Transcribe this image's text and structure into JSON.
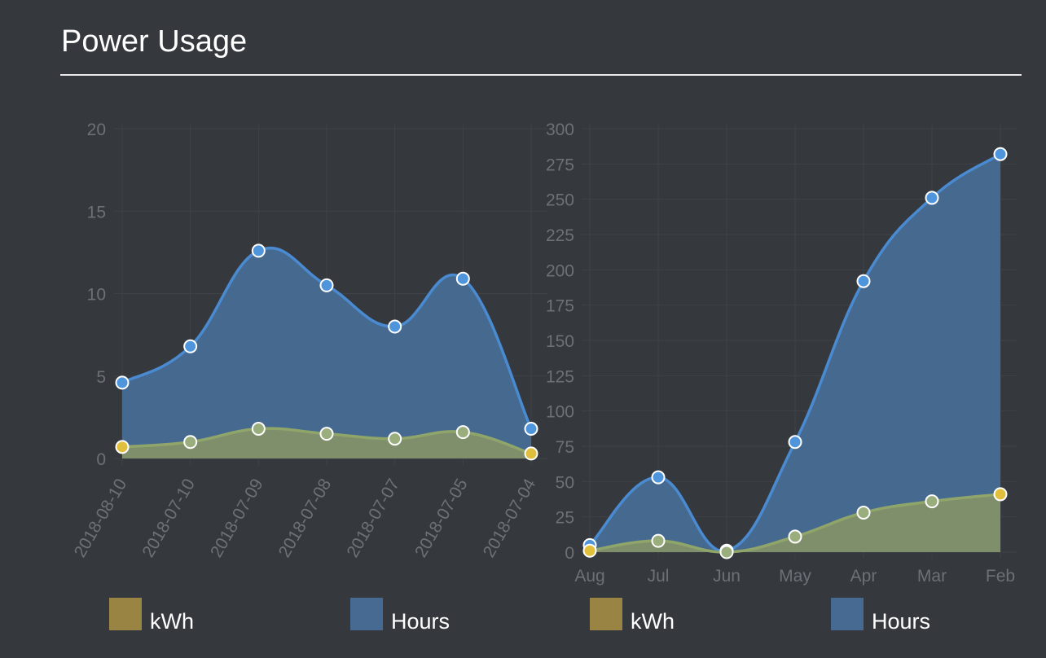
{
  "page": {
    "title": "Power Usage"
  },
  "colors": {
    "kwh_swatch": "#9a8444",
    "hours_swatch": "#466a92",
    "kwh_line": "#8fa56a",
    "kwh_fill": "#7f8f6c",
    "hours_line": "#4a8ad0",
    "hours_fill": "#45698f",
    "point_blue": "#4f95dc",
    "point_yellow": "#e0bf3c",
    "point_green": "#9aad7c",
    "grid": "#3f4248",
    "tick_text": "#6d7076"
  },
  "chart_data": [
    {
      "type": "area",
      "categories": [
        "2018-08-10",
        "2018-07-10",
        "2018-07-09",
        "2018-07-08",
        "2018-07-07",
        "2018-07-05",
        "2018-07-04"
      ],
      "series": [
        {
          "name": "kWh",
          "values": [
            0.7,
            1.0,
            1.8,
            1.5,
            1.2,
            1.6,
            0.3
          ]
        },
        {
          "name": "Hours",
          "values": [
            4.6,
            6.8,
            12.6,
            10.5,
            8.0,
            10.9,
            1.8
          ]
        }
      ],
      "yticks": [
        0,
        5,
        10,
        15,
        20
      ],
      "ylim": [
        0,
        20
      ],
      "grid": true,
      "legend": "bottom",
      "legend_labels": [
        "kWh",
        "Hours"
      ]
    },
    {
      "type": "area",
      "categories": [
        "Aug",
        "Jul",
        "Jun",
        "May",
        "Apr",
        "Mar",
        "Feb"
      ],
      "series": [
        {
          "name": "kWh",
          "values": [
            1,
            8,
            0,
            11,
            28,
            36,
            41
          ]
        },
        {
          "name": "Hours",
          "values": [
            5,
            53,
            1,
            78,
            192,
            251,
            282
          ]
        }
      ],
      "yticks": [
        0,
        25,
        50,
        75,
        100,
        125,
        150,
        175,
        200,
        225,
        250,
        275,
        300
      ],
      "ylim": [
        0,
        300
      ],
      "grid": true,
      "legend": "bottom",
      "legend_labels": [
        "kWh",
        "Hours"
      ]
    }
  ]
}
